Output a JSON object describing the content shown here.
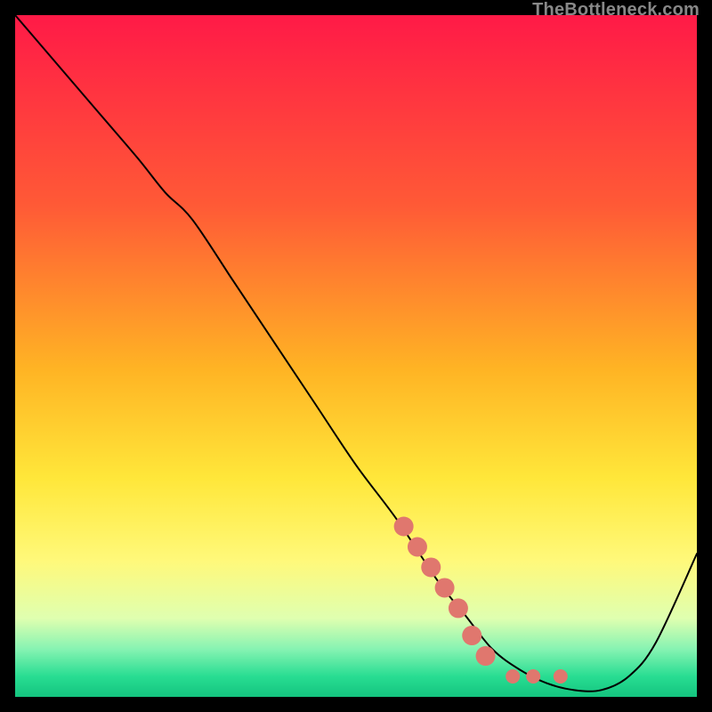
{
  "watermark": "TheBottleneck.com",
  "chart_data": {
    "type": "line",
    "title": "",
    "xlabel": "",
    "ylabel": "",
    "xlim": [
      0,
      100
    ],
    "ylim": [
      0,
      100
    ],
    "grid": false,
    "legend": false,
    "background_gradient_stops": [
      {
        "offset": 0.0,
        "color": "#ff1a47"
      },
      {
        "offset": 0.28,
        "color": "#ff5a36"
      },
      {
        "offset": 0.52,
        "color": "#ffb424"
      },
      {
        "offset": 0.68,
        "color": "#ffe73a"
      },
      {
        "offset": 0.8,
        "color": "#fff97a"
      },
      {
        "offset": 0.885,
        "color": "#dfffb0"
      },
      {
        "offset": 0.93,
        "color": "#86f3b2"
      },
      {
        "offset": 0.97,
        "color": "#28dd92"
      },
      {
        "offset": 1.0,
        "color": "#14c47f"
      }
    ],
    "series": [
      {
        "name": "curve",
        "color": "#000000",
        "stroke_width": 2,
        "x": [
          0,
          6,
          12,
          18,
          22,
          26,
          32,
          38,
          44,
          50,
          56,
          62,
          66,
          70,
          74,
          78,
          82,
          86,
          90,
          94,
          100
        ],
        "y": [
          100,
          93,
          86,
          79,
          74,
          70,
          61,
          52,
          43,
          34,
          26,
          17,
          12,
          7,
          4,
          2,
          1,
          1,
          3,
          8,
          21
        ]
      },
      {
        "name": "dots",
        "type": "scatter",
        "color": "#e0776e",
        "x": [
          57,
          59,
          61,
          63,
          65,
          67,
          69,
          73,
          76,
          80
        ],
        "y": [
          25,
          22,
          19,
          16,
          13,
          9,
          6,
          3,
          3,
          3
        ],
        "size": [
          11,
          11,
          11,
          11,
          11,
          11,
          11,
          8,
          8,
          8
        ]
      }
    ]
  }
}
